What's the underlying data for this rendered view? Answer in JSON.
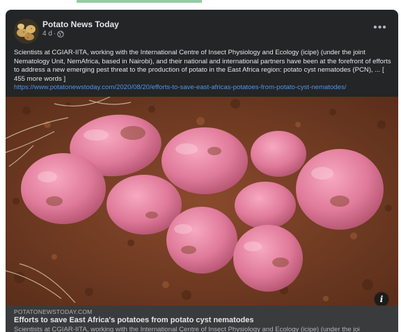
{
  "post": {
    "page_name": "Potato News Today",
    "time": "4 d",
    "separator": "·",
    "more_label": "•••",
    "body_text": "Scientists at CGIAR-IITA, working with the International Centre of Insect Physiology and Ecology (icipe) (under the joint Nematology Unit, NemAfrica, based in Nairobi), and their national and international partners have been at the forefront of efforts to address a new emerging pest threat to the production of potato in the East Africa region: potato cyst nematodes (PCN), ... [ 455 more words ]",
    "link_url": "https://www.potatonewstoday.com/2020/08/20/efforts-to-save-east-africas-potatoes-from-potato-cyst-nematodes/"
  },
  "preview": {
    "domain": "POTATONEWSTODAY.COM",
    "title": "Efforts to save East Africa's potatoes from potato cyst nematodes",
    "description": "Scientists at CGIAR-IITA, working with the International Centre of Insect Physiology and Ecology (icipe) (under the joi",
    "info_label": "i"
  },
  "colors": {
    "card_bg": "#242526",
    "link": "#4e96e8",
    "preview_bg": "#3a3b3c",
    "potato_skin": "#e07a9a",
    "soil": "#6b3a24"
  },
  "icons": {
    "privacy": "globe-icon",
    "menu": "more-options-icon",
    "info": "info-icon"
  }
}
